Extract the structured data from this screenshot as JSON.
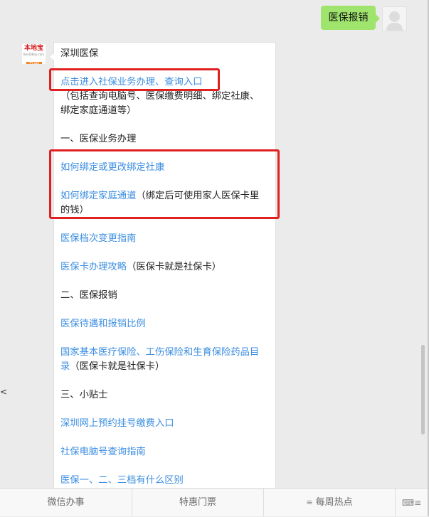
{
  "outgoing": {
    "text": "医保报销"
  },
  "bot_avatar": {
    "brand": "本地宝",
    "site": "BenDiBao.com",
    "city": "深圳"
  },
  "message": {
    "title": "深圳医保",
    "link_entry": "点击进入社保业务办理、查询入口",
    "entry_note_1": "（包括查询电脑号、医保缴费明细、绑定社康、",
    "entry_note_2": "绑定家庭通道等）",
    "section1": "一、医保业务办理",
    "link_bind_sk": "如何绑定或更改绑定社康",
    "link_family": "如何绑定家庭通道",
    "family_note": "（绑定后可使用家人医保卡里",
    "family_note_2": "的钱）",
    "link_grade": "医保档次变更指南",
    "link_card": "医保卡办理攻略",
    "card_note": "（医保卡就是社保卡）",
    "section2": "二、医保报销",
    "link_ratio": "医保待遇和报销比例",
    "link_catalog_1": "国家基本医疗保险、工伤保险和生育保险药品目",
    "link_catalog_2": "录",
    "catalog_note": "（医保卡就是社保卡）",
    "section3": "三、小贴士",
    "link_register": "深圳网上预约挂号缴费入口",
    "link_computer_no": "社保电脑号查询指南",
    "link_levels": "医保一、二、三档有什么区别"
  },
  "side_glyph": "<",
  "bottom_menu": {
    "item1": "微信办事",
    "item2": "特惠门票",
    "item3": "每周热点",
    "menu_icon": "≡",
    "keyboard_icon": "⌨≡"
  },
  "colors": {
    "link": "#3c8ee0",
    "highlight": "#e02020",
    "outgoing_bubble": "#9fe46c"
  }
}
